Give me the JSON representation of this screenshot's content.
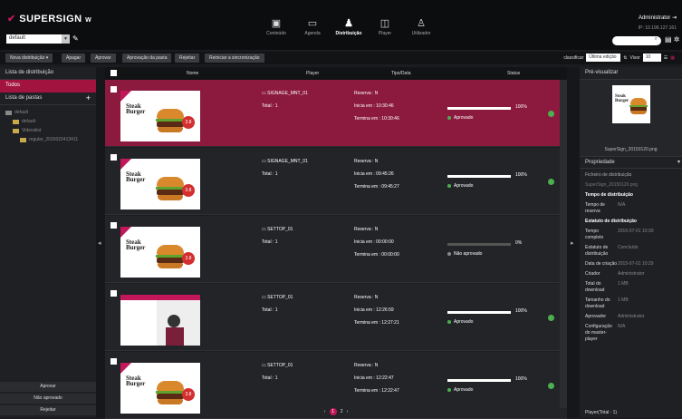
{
  "app": {
    "logo": "SUPERSIGN",
    "logo_suffix": "W",
    "site": "default"
  },
  "nav": [
    {
      "label": "Conteúdo",
      "icon": "▣"
    },
    {
      "label": "Agenda",
      "icon": "▭"
    },
    {
      "label": "Distribuição",
      "icon": "♟"
    },
    {
      "label": "Player",
      "icon": "◫"
    },
    {
      "label": "Utilizador",
      "icon": "♙"
    }
  ],
  "user": {
    "name": "Administrator",
    "ip": "IP: 10.196.127.161"
  },
  "toolbar": {
    "new_dist": "Nova distribuição",
    "delete": "Apagar",
    "approve": "Aprovar",
    "approve_folder": "Aprovação da pasta",
    "reject": "Rejeitar",
    "restart_sync": "Reiniciar a sincronização",
    "sort_label": "classificar",
    "sort_value": "Última edição",
    "view_label": "Visor",
    "view_value": "10"
  },
  "left": {
    "title": "Lista de distribuição",
    "all": "Todos",
    "folders": "Lista de pastas",
    "tree": [
      "default",
      "default",
      "Videoslist",
      "regular_2015022413411"
    ],
    "approve": "Aprovar",
    "not_approved": "Não aprovado",
    "reject": "Rejeitar"
  },
  "table": {
    "headers": {
      "name": "Nome",
      "player": "Player",
      "type": "Tipo/Data",
      "status": "Status"
    },
    "rows": [
      {
        "player": "SIGNAGE_MNT_01",
        "total": "Total : 1",
        "reserve": "Reserva : N",
        "start": "Inicia em : 10:30:46",
        "end": "Termina em : 10:30:46",
        "pct": "100%",
        "status": "Aprovado",
        "fill": 1,
        "thumb": "burger"
      },
      {
        "player": "SIGNAGE_MNT_01",
        "total": "Total : 1",
        "reserve": "Reserva : N",
        "start": "Inicia em : 09:45:26",
        "end": "Termina em : 09:45:27",
        "pct": "100%",
        "status": "Aprovado",
        "fill": 1,
        "thumb": "burger"
      },
      {
        "player": "SETTOP_01",
        "total": "Total : 1",
        "reserve": "Reserva : N",
        "start": "Inicia em : 00:00:00",
        "end": "Termina em : 00:00:00",
        "pct": "0%",
        "status": "Não aprovado",
        "fill": 0,
        "thumb": "burger"
      },
      {
        "player": "SETTOP_01",
        "total": "Total : 1",
        "reserve": "Reserva : N",
        "start": "Inicia em : 12:26:59",
        "end": "Termina em : 12:27:21",
        "pct": "100%",
        "status": "Aprovado",
        "fill": 1,
        "thumb": "poster"
      },
      {
        "player": "SETTOP_01",
        "total": "Total : 1",
        "reserve": "Reserva : N",
        "start": "Inicia em : 12:22:47",
        "end": "Termina em : 12:22:47",
        "pct": "100%",
        "status": "Aprovado",
        "fill": 1,
        "thumb": "burger"
      }
    ],
    "thumb_text": "Steak Burger",
    "thumb_price": "3.8"
  },
  "pager": {
    "prev": "‹",
    "current": "1",
    "next": "2",
    "last": "›"
  },
  "right": {
    "preview_title": "Pré-visualizar",
    "filename": "SuperSign_20150120.png",
    "properties": "Propriedade",
    "props": [
      {
        "k": "Ficheiro de distribuição",
        "v": ""
      },
      {
        "k": "SuperSign_20150120.png",
        "v": ""
      },
      {
        "k": "Tempo de distribuição",
        "v": ""
      },
      {
        "k": "Tempo de reserva",
        "v": "N/A"
      }
    ],
    "dist_state": "Estatuto de distribuição",
    "state_props": [
      {
        "k": "Tempo completo",
        "v": "2015-07-01 10:30"
      },
      {
        "k": "Estatuto de distribuição",
        "v": "Concluído"
      },
      {
        "k": "Data de criação",
        "v": "2015-07-01 10:29"
      },
      {
        "k": "Criador",
        "v": "Administrator"
      },
      {
        "k": "Total do download",
        "v": "1 MB"
      },
      {
        "k": "Tamanho do download",
        "v": "1 MB"
      },
      {
        "k": "Aprovador",
        "v": "Administrator"
      },
      {
        "k": "Configuração do master-player",
        "v": "N/A"
      }
    ],
    "footer": "Player(Total : 1)"
  },
  "colors": {
    "accent": "#a3133f",
    "ok": "#4caf50"
  }
}
